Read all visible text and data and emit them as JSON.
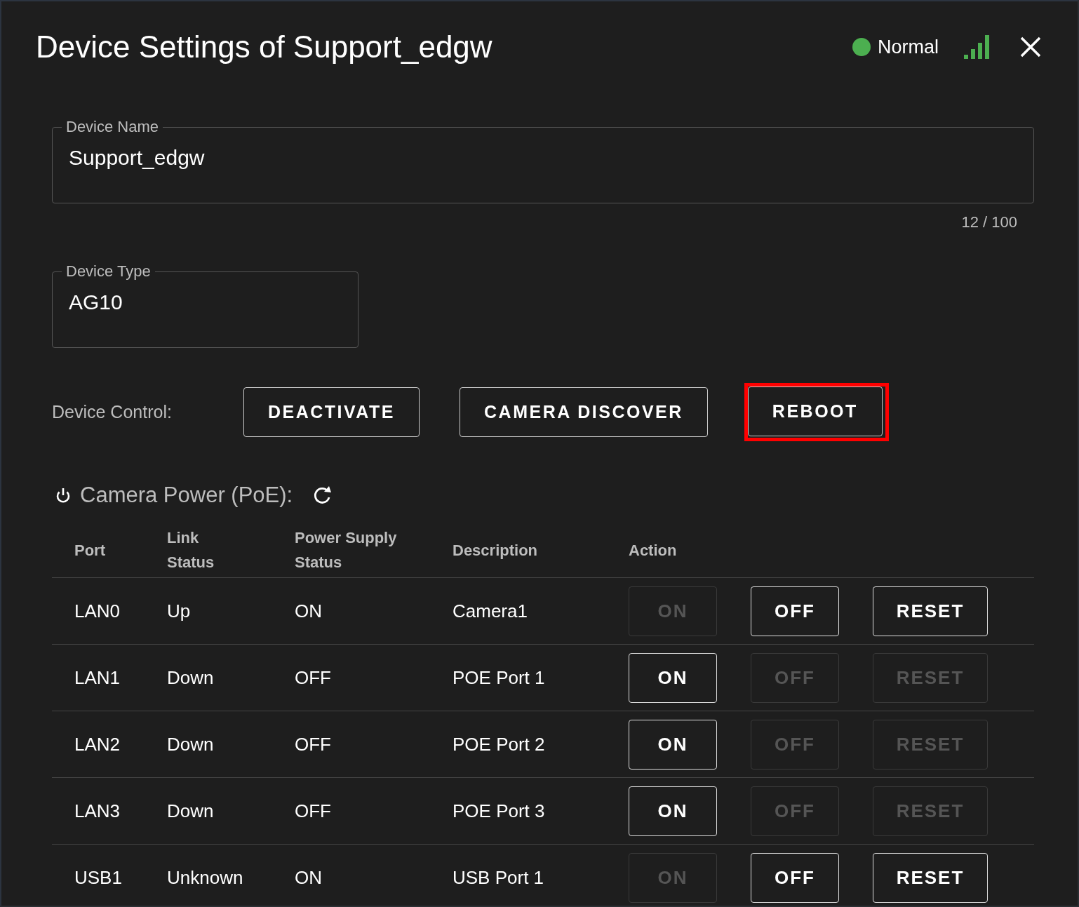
{
  "window": {
    "title": "Device Settings of Support_edgw",
    "status": {
      "label": "Normal",
      "color": "#4caf50"
    }
  },
  "device_name": {
    "label": "Device Name",
    "value": "Support_edgw",
    "counter": "12 / 100"
  },
  "device_type": {
    "label": "Device Type",
    "value": "AG10"
  },
  "device_control": {
    "label": "Device Control:",
    "buttons": [
      {
        "label": "DEACTIVATE",
        "highlighted": false
      },
      {
        "label": "CAMERA DISCOVER",
        "highlighted": false
      },
      {
        "label": "REBOOT",
        "highlighted": true
      }
    ]
  },
  "camera_power": {
    "title": "Camera Power (PoE):",
    "columns": [
      "Port",
      "Link Status",
      "Power Supply Status",
      "Description",
      "Action"
    ],
    "rows": [
      {
        "port": "LAN0",
        "link_status": "Up",
        "power_supply_status": "ON",
        "description": "Camera1",
        "actions": [
          {
            "label": "ON",
            "disabled": true
          },
          {
            "label": "OFF",
            "disabled": false
          },
          {
            "label": "RESET",
            "disabled": false
          }
        ]
      },
      {
        "port": "LAN1",
        "link_status": "Down",
        "power_supply_status": "OFF",
        "description": "POE Port 1",
        "actions": [
          {
            "label": "ON",
            "disabled": false
          },
          {
            "label": "OFF",
            "disabled": true
          },
          {
            "label": "RESET",
            "disabled": true
          }
        ]
      },
      {
        "port": "LAN2",
        "link_status": "Down",
        "power_supply_status": "OFF",
        "description": "POE Port 2",
        "actions": [
          {
            "label": "ON",
            "disabled": false
          },
          {
            "label": "OFF",
            "disabled": true
          },
          {
            "label": "RESET",
            "disabled": true
          }
        ]
      },
      {
        "port": "LAN3",
        "link_status": "Down",
        "power_supply_status": "OFF",
        "description": "POE Port 3",
        "actions": [
          {
            "label": "ON",
            "disabled": false
          },
          {
            "label": "OFF",
            "disabled": true
          },
          {
            "label": "RESET",
            "disabled": true
          }
        ]
      },
      {
        "port": "USB1",
        "link_status": "Unknown",
        "power_supply_status": "ON",
        "description": "USB Port 1",
        "actions": [
          {
            "label": "ON",
            "disabled": true
          },
          {
            "label": "OFF",
            "disabled": false
          },
          {
            "label": "RESET",
            "disabled": false
          }
        ]
      }
    ]
  }
}
